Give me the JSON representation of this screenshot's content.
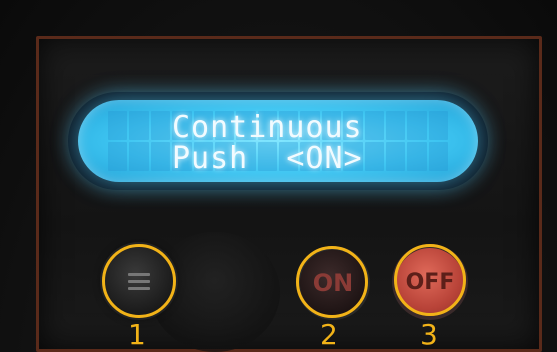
{
  "lcd": {
    "line1": "Continuous",
    "line2": "Push  <ON>"
  },
  "buttons": {
    "menu": {
      "icon": "menu-icon"
    },
    "on": {
      "label": "ON"
    },
    "off": {
      "label": "OFF"
    }
  },
  "markers": {
    "one": "1",
    "two": "2",
    "three": "3"
  },
  "colors": {
    "lcd_backlight": "#3fc6f2",
    "marker_ring": "#f2b318",
    "off_button": "#b84338"
  }
}
